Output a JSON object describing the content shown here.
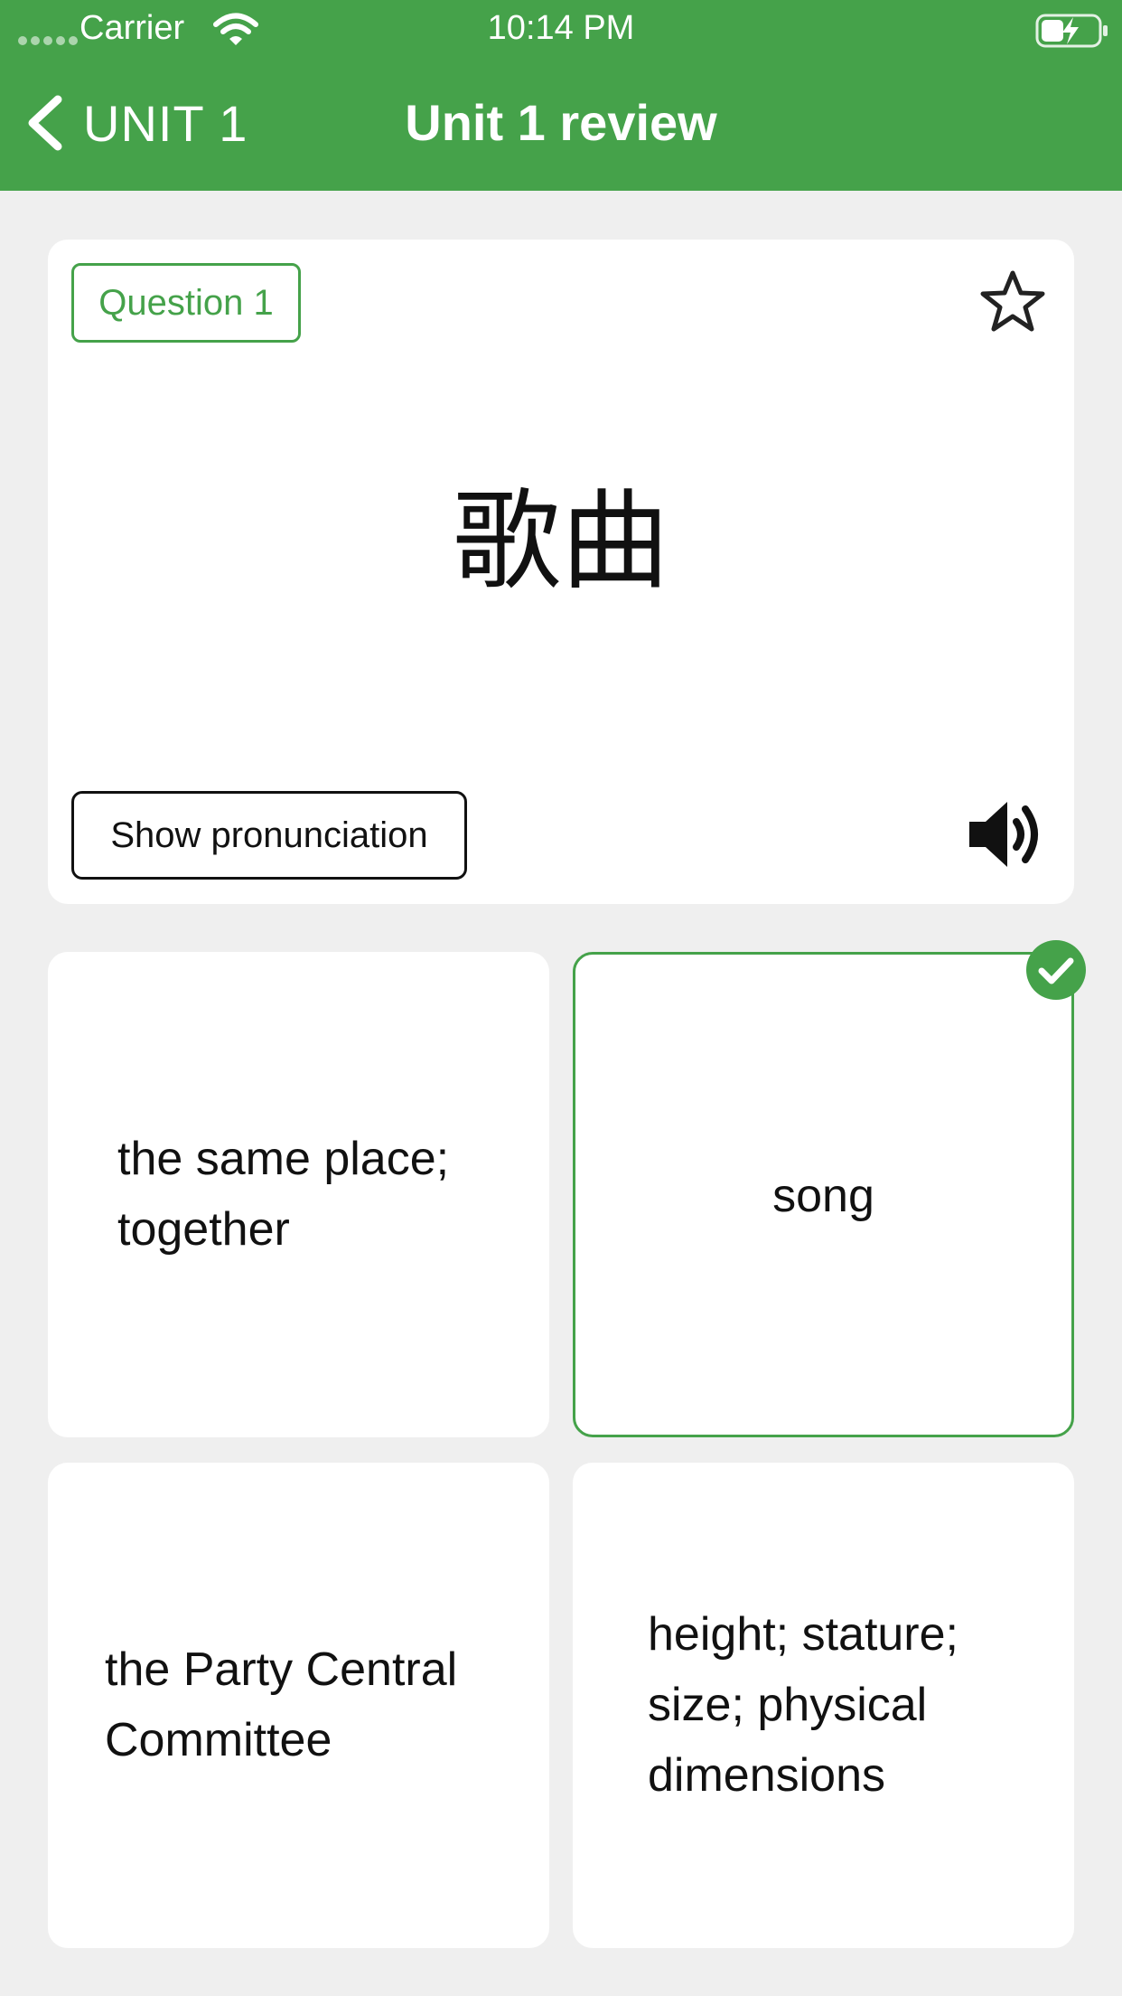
{
  "status_bar": {
    "carrier": "Carrier",
    "time": "10:14 PM",
    "icons": [
      "signal-dots-icon",
      "wifi-icon",
      "battery-charging-icon"
    ]
  },
  "nav": {
    "back_label": "UNIT 1",
    "title": "Unit 1 review",
    "background_color": "#45a24a"
  },
  "question": {
    "badge": "Question 1",
    "word": "歌曲",
    "show_pronunciation_label": "Show pronunciation",
    "icons": [
      "star-icon",
      "speaker-icon"
    ]
  },
  "options": [
    {
      "text": "the same place; together",
      "correct": false
    },
    {
      "text": "song",
      "correct": true
    },
    {
      "text": "the Party Central Committee",
      "correct": false
    },
    {
      "text": "height; stature; size; physical dimensions",
      "correct": false
    }
  ],
  "colors": {
    "accent": "#45a24a",
    "page_background": "#efefef",
    "card_background": "#ffffff",
    "text": "#111111"
  }
}
